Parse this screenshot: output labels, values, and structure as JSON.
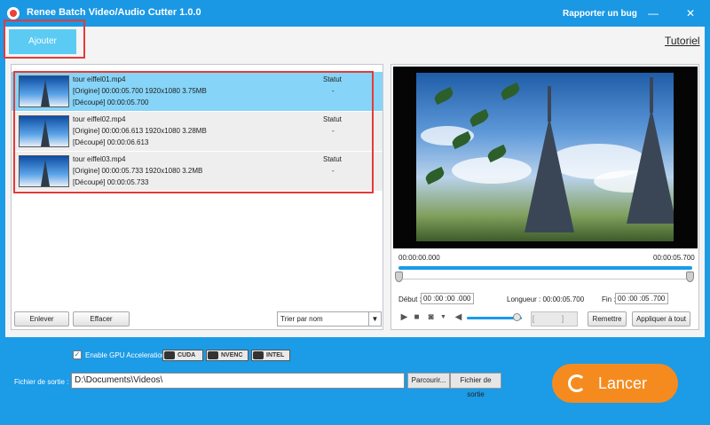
{
  "titlebar": {
    "title": "Renee Batch Video/Audio Cutter 1.0.0",
    "report_bug": "Rapporter un bug",
    "minimize": "—",
    "close": "✕"
  },
  "toolbar": {
    "add_label": "Ajouter",
    "tutorial_label": "Tutoriel"
  },
  "files": [
    {
      "name": "tour eiffel01.mp4",
      "origin": "[Origine]     00:00:05.700   1920x1080   3.75MB",
      "cut": "[Découpé]   00:00:05.700",
      "status_header": "Statut",
      "status": "-"
    },
    {
      "name": "tour eiffel02.mp4",
      "origin": "[Origine]     00:00:06.613   1920x1080   3.28MB",
      "cut": "[Découpé]   00:00:06.613",
      "status_header": "Statut",
      "status": "-"
    },
    {
      "name": "tour eiffel03.mp4",
      "origin": "[Origine]     00:00:05.733   1920x1080   3.2MB",
      "cut": "[Découpé]   00:00:05.733",
      "status_header": "Statut",
      "status": "-"
    }
  ],
  "list_controls": {
    "remove_label": "Enlever",
    "clear_label": "Effacer",
    "sort_value": "Trier par nom",
    "sort_arrow": "▼"
  },
  "preview": {
    "time_start": "00:00:00.000",
    "time_end": "00:00:05.700",
    "start_label": "Début :",
    "start_value": "00 :00 :00 .000",
    "length_label": "Longueur : 00:00:05.700",
    "end_label": "Fin :",
    "end_value": "00 :00 :05 .700",
    "play": "▶",
    "stop": "■",
    "camera": "◙",
    "camera_dropdown": "▼",
    "volume": "◀",
    "mark_buttons": "[ ]",
    "reset_label": "Remettre",
    "apply_all_label": "Appliquer à tout",
    "volume_level": 0.9
  },
  "gpu": {
    "checkmark": "✓",
    "label": "Enable GPU Acceleration",
    "badges": [
      "CUDA",
      "NVENC",
      "INTEL"
    ]
  },
  "output": {
    "label": "Fichier de sortie :",
    "path": "D:\\Documents\\Videos\\",
    "browse_label": "Parcourir...",
    "open_folder_label": "Fichier de sortie"
  },
  "launch": {
    "label": "Lancer"
  },
  "colors": {
    "accent": "#1c9be6",
    "selected_row": "#86d4f8",
    "highlight": "#e53a3a",
    "launch": "#f58b1f",
    "add_button": "#5ccbf3"
  }
}
